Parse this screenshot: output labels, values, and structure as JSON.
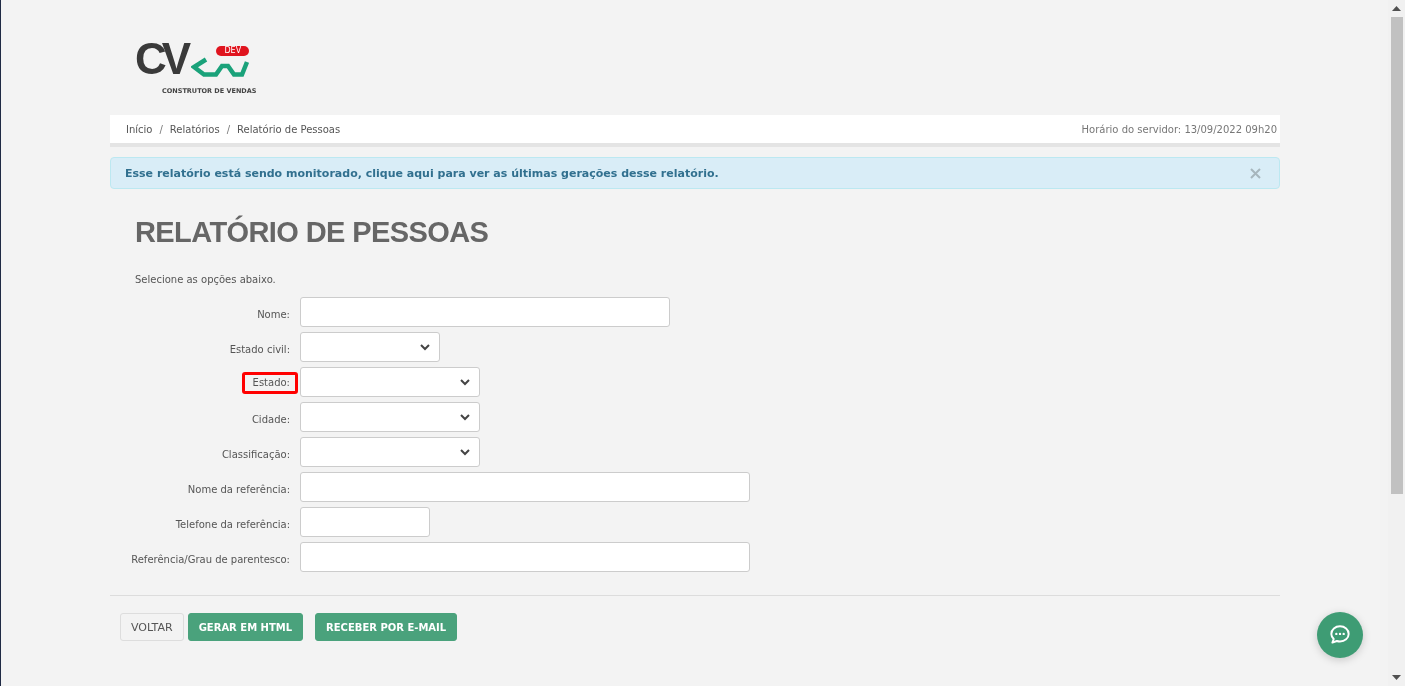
{
  "logo": {
    "letters": "CV",
    "badge": "DEV",
    "tagline": "CONSTRUTOR DE VENDAS"
  },
  "breadcrumb": {
    "items": [
      {
        "label": "Início",
        "separator": "/"
      },
      {
        "label": "Relatórios",
        "separator": "/"
      },
      {
        "label": "Relatório de Pessoas"
      }
    ],
    "server_time": "Horário do servidor: 13/09/2022 09h20"
  },
  "alert": {
    "message": "Esse relatório está sendo monitorado, clique aqui para ver as últimas gerações desse relatório."
  },
  "title": "RELATÓRIO DE PESSOAS",
  "instruction": "Selecione as opções abaixo.",
  "form": {
    "fields": [
      {
        "label": "Nome:",
        "kind": "text",
        "highlighted": false
      },
      {
        "label": "Estado civil:",
        "kind": "select",
        "highlighted": false
      },
      {
        "label": "Estado:",
        "kind": "select",
        "highlighted": true
      },
      {
        "label": "Cidade:",
        "kind": "select",
        "highlighted": false
      },
      {
        "label": "Classificação:",
        "kind": "select",
        "highlighted": false
      },
      {
        "label": "Nome da referência:",
        "kind": "text",
        "highlighted": false
      },
      {
        "label": "Telefone da referência:",
        "kind": "text",
        "highlighted": false
      },
      {
        "label": "Referência/Grau de parentesco:",
        "kind": "text",
        "highlighted": false
      }
    ]
  },
  "buttons": [
    {
      "label": "VOLTAR",
      "kind": "secondary"
    },
    {
      "label": "GERAR EM HTML",
      "kind": "primary"
    },
    {
      "label": "RECEBER POR E-MAIL",
      "kind": "primary"
    }
  ]
}
